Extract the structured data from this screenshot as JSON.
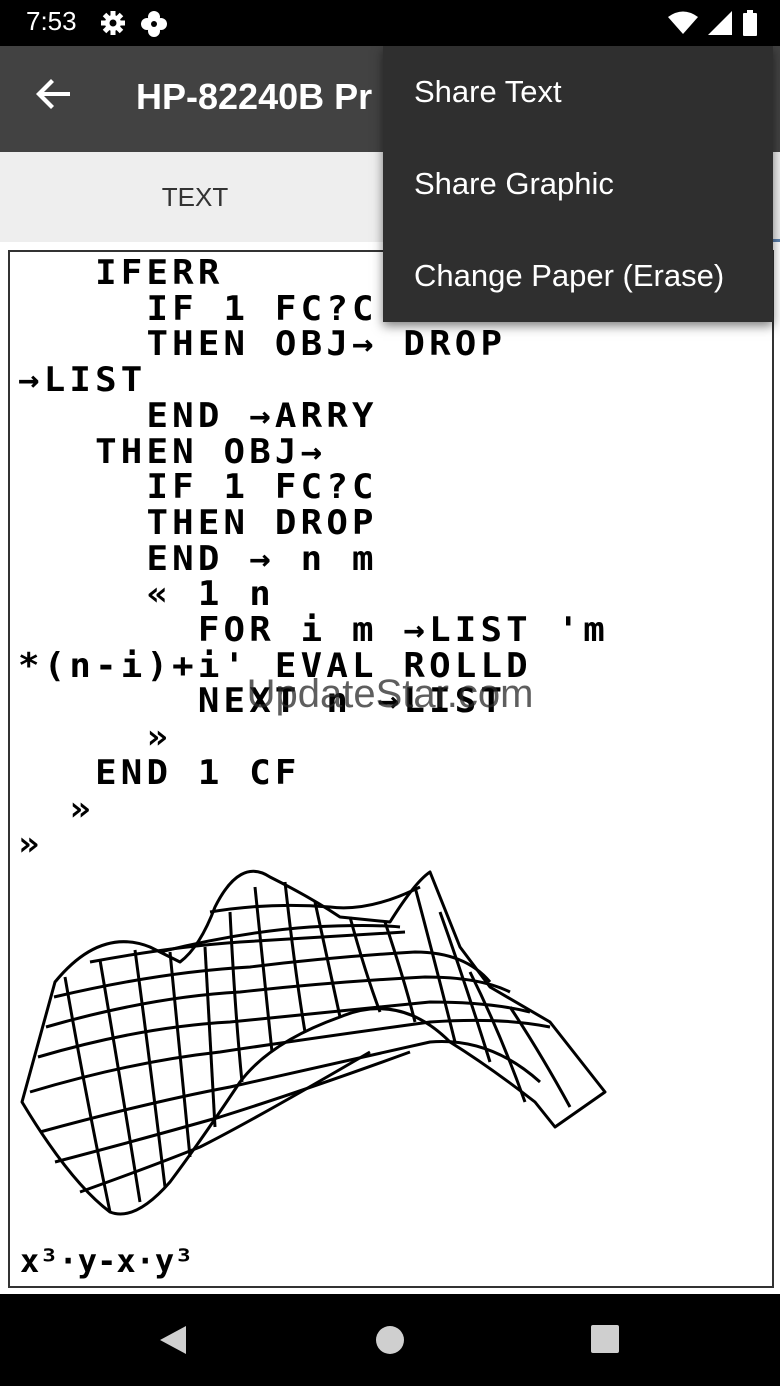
{
  "status_bar": {
    "time": "7:53"
  },
  "app_bar": {
    "title": "HP-82240B Pr"
  },
  "tabs": [
    {
      "label": "TEXT"
    },
    {
      "label": ""
    }
  ],
  "menu": {
    "items": [
      {
        "label": "Share Text"
      },
      {
        "label": "Share Graphic"
      },
      {
        "label": "Change Paper (Erase)"
      }
    ]
  },
  "printout": {
    "text": "   IFERR\n     IF 1 FC?C\n     THEN OBJ→ DROP\n→LIST\n     END →ARRY\n   THEN OBJ→\n     IF 1 FC?C\n     THEN DROP\n     END → n m\n     « 1 n\n       FOR i m →LIST 'm\n*(n-i)+i' EVAL ROLLD\n       NEXT n →LIST\n     »\n   END 1 CF\n  »\n»",
    "formula": "x³·y-x·y³"
  },
  "watermark": "UpdateStar.com",
  "colors": {
    "status_bar": "#000000",
    "app_bar": "#424242",
    "tab_bar": "#eeeeee",
    "menu": "#2f2f2f",
    "tab_indicator": "#5c7faa"
  },
  "icons": {
    "status": [
      "gear-icon",
      "flower-icon",
      "wifi-icon",
      "signal-icon",
      "battery-icon"
    ],
    "app_bar": "back-arrow-icon",
    "nav": [
      "back-triangle-icon",
      "home-circle-icon",
      "recents-square-icon"
    ]
  }
}
